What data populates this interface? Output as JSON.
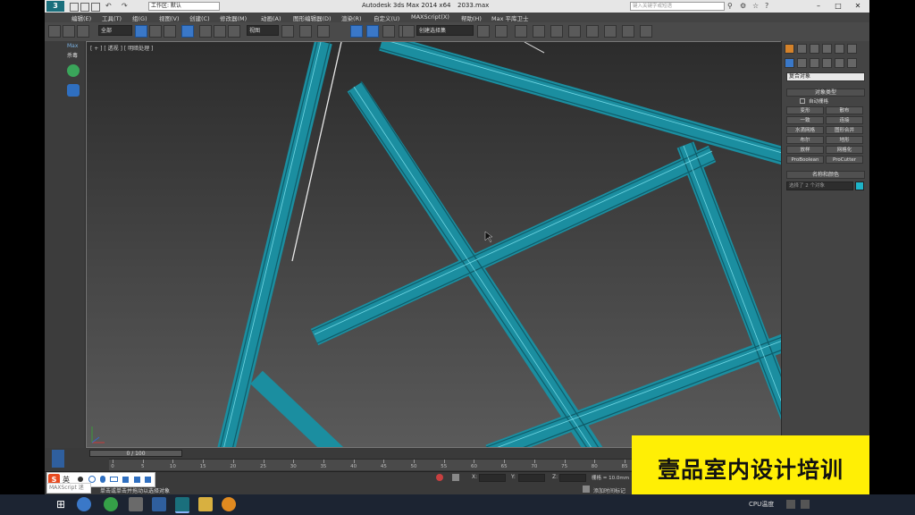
{
  "window": {
    "title": "Autodesk 3ds Max  2014 x64",
    "filename": "2033.max",
    "workspace": "工作区: 默认",
    "search_placeholder": "键入关键字或短语"
  },
  "menu": {
    "items": [
      "编辑(E)",
      "工具(T)",
      "组(G)",
      "视图(V)",
      "创建(C)",
      "修改器(M)",
      "动画(A)",
      "图形编辑器(D)",
      "渲染(R)",
      "自定义(U)",
      "MAXScript(X)",
      "帮助(H)",
      "Max 平库卫士"
    ]
  },
  "toolbar": {
    "selection_filter": "全部",
    "ref_coord": "视图",
    "named_selection": "创建选择集"
  },
  "left_panel": {
    "label_top": "Max",
    "label_bottom": "杀毒"
  },
  "viewport": {
    "label": "[ + ] [ 透视 ] [ 明暗处理 ]"
  },
  "command_panel": {
    "category": "复合对象",
    "rollout_object_type": "对象类型",
    "auto_grid": "自动栅格",
    "buttons": [
      "变形",
      "散布",
      "一致",
      "连接",
      "水滴网格",
      "图形合并",
      "布尔",
      "地形",
      "放样",
      "网格化",
      "ProBoolean",
      "ProCutter"
    ],
    "rollout_name_color": "名称和颜色",
    "name_placeholder": "选择了 2 个对象",
    "name_color": "#1eb4c8"
  },
  "timeline": {
    "slider_label": "0 / 100",
    "ticks": [
      "0",
      "5",
      "10",
      "15",
      "20",
      "25",
      "30",
      "35",
      "40",
      "45",
      "50",
      "55",
      "60",
      "65",
      "70",
      "75",
      "80",
      "85"
    ]
  },
  "status": {
    "hint": "单击或单击并拖动以选择对象",
    "x_label": "X:",
    "y_label": "Y:",
    "z_label": "Z:",
    "grid": "栅格 = 10.0mm",
    "add_time_tag": "添加时间标记",
    "maxscript_label": "MAXScript 迷"
  },
  "ime": {
    "lang": "英"
  },
  "taskbar": {
    "cpu_label": "CPU温度"
  },
  "watermark": {
    "text": "壹品室内设计培训"
  },
  "colors": {
    "frame_teal": "#1b8ea0",
    "accent_blue": "#3a78c8",
    "watermark_bg": "#ffef05"
  }
}
